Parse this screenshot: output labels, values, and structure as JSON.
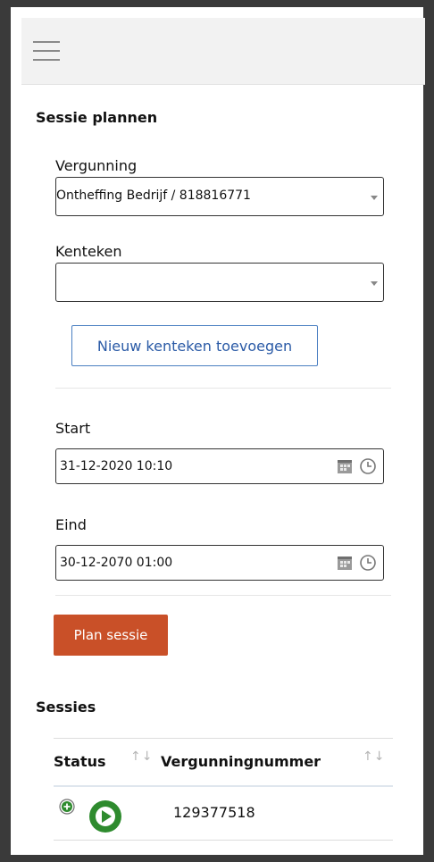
{
  "header": {
    "menu_icon": "hamburger-icon"
  },
  "plan": {
    "title": "Sessie plannen",
    "vergunning": {
      "label": "Vergunning",
      "selected": "Ontheffing Bedrijf / 818816771"
    },
    "kenteken": {
      "label": "Kenteken",
      "selected": ""
    },
    "add_plate_button": "Nieuw kenteken toevoegen",
    "start": {
      "label": "Start",
      "value": "31-12-2020 10:10"
    },
    "eind": {
      "label": "Eind",
      "value": "30-12-2070 01:00"
    },
    "submit_button": "Plan sessie"
  },
  "sessions": {
    "title": "Sessies",
    "columns": [
      "Status",
      "Vergunningnummer"
    ],
    "rows": [
      {
        "status_icon": "play-circle-icon",
        "vergunningnummer": "129377518"
      }
    ]
  },
  "colors": {
    "primary": "#c95028",
    "link": "#2a5aa6",
    "status_active": "#2e8b2e"
  }
}
